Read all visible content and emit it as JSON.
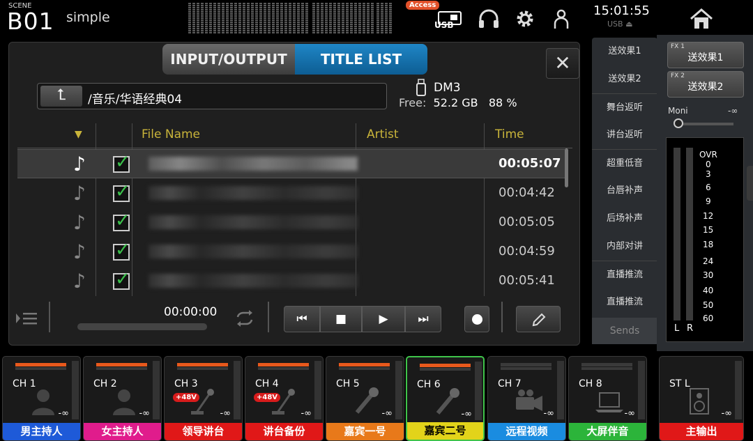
{
  "header": {
    "scene_label": "SCENE",
    "scene_number": "B01",
    "scene_name": "simple",
    "access_badge": "Access",
    "usb_label": "USB",
    "clock": "15:01:55",
    "usb_status": "USB"
  },
  "tabs": {
    "input_output": "INPUT/OUTPUT",
    "title_list": "TITLE LIST"
  },
  "path": "/音乐/华语经典04",
  "drive": {
    "name": "DM3",
    "free_label": "Free:",
    "free_size": "52.2 GB",
    "free_pct": "88 %"
  },
  "table": {
    "sort_indicator": "▼",
    "headers": {
      "file_name": "File Name",
      "artist": "Artist",
      "time": "Time"
    },
    "rows": [
      {
        "time": "00:05:07",
        "selected": true
      },
      {
        "time": "00:04:42",
        "selected": false
      },
      {
        "time": "00:05:05",
        "selected": false
      },
      {
        "time": "00:04:59",
        "selected": false
      },
      {
        "time": "00:05:41",
        "selected": false
      }
    ]
  },
  "transport": {
    "elapsed": "00:00:00"
  },
  "sends": {
    "items": [
      "送效果1",
      "送效果2",
      "舞台返听",
      "讲台返听",
      "超重低音",
      "台唇补声",
      "后场补声",
      "内部对讲",
      "直播推流",
      "直播推流"
    ],
    "tab_label": "Sends"
  },
  "fx": {
    "fx1_small": "FX 1",
    "fx1_label": "送效果1",
    "fx2_small": "FX 2",
    "fx2_label": "送效果2",
    "moni_label": "Moni",
    "moni_value": "-∞",
    "meter_scale": [
      "OVR",
      "0",
      "3",
      "6",
      "9",
      "12",
      "15",
      "18",
      "24",
      "30",
      "40",
      "50",
      "60"
    ],
    "left_label": "L",
    "right_label": "R"
  },
  "channels": [
    {
      "id": "CH 1",
      "label": "男主持人",
      "color": "#1e5ad8",
      "icon": "person-icon",
      "phantom": "",
      "level": "-∞",
      "active": false
    },
    {
      "id": "CH 2",
      "label": "女主持人",
      "color": "#e01c8c",
      "icon": "person-icon",
      "phantom": "",
      "level": "-∞",
      "active": false
    },
    {
      "id": "CH 3",
      "label": "领导讲台",
      "color": "#e01818",
      "icon": "podium-mic-icon",
      "phantom": "+48V",
      "level": "-∞",
      "active": false
    },
    {
      "id": "CH 4",
      "label": "讲台备份",
      "color": "#e01818",
      "icon": "podium-mic-icon",
      "phantom": "+48V",
      "level": "-∞",
      "active": false
    },
    {
      "id": "CH 5",
      "label": "嘉宾一号",
      "color": "#e8791a",
      "icon": "handheld-mic-icon",
      "phantom": "",
      "level": "-∞",
      "active": false
    },
    {
      "id": "CH 6",
      "label": "嘉宾二号",
      "color": "#e2d31a",
      "icon": "handheld-mic-icon",
      "phantom": "",
      "level": "-∞",
      "active": true
    },
    {
      "id": "CH 7",
      "label": "远程视频",
      "color": "#1a8ce0",
      "icon": "video-camera-icon",
      "phantom": "",
      "level": "-∞",
      "active": false
    },
    {
      "id": "CH 8",
      "label": "大屏伴音",
      "color": "#2cb43a",
      "icon": "laptop-icon",
      "phantom": "",
      "level": "-∞",
      "active": false
    },
    {
      "id": "ST L",
      "label": "主输出",
      "color": "#e01818",
      "icon": "speaker-icon",
      "phantom": "",
      "level": "-∞",
      "active": false
    }
  ]
}
